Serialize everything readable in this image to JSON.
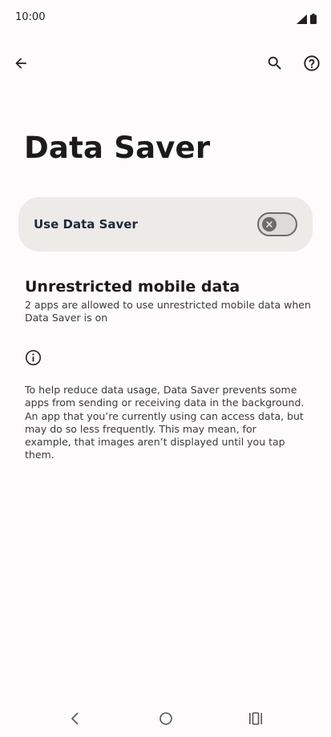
{
  "status_bar": {
    "time": "10:00",
    "icons": [
      "signal-icon",
      "battery-icon"
    ]
  },
  "toolbar": {
    "back_icon": "arrow-back-icon",
    "search_icon": "search-icon",
    "help_icon": "help-icon"
  },
  "page": {
    "title": "Data Saver"
  },
  "main_switch": {
    "label": "Use Data Saver",
    "state": "off"
  },
  "unrestricted_pref": {
    "title": "Unrestricted mobile data",
    "summary": "2 apps are allowed to use unrestricted mobile data when Data Saver is on"
  },
  "footer": {
    "icon": "info-icon",
    "text": "To help reduce data usage, Data Saver prevents some apps from sending or receiving data in the background. An app that you’re currently using can access data, but may do so less frequently. This may mean, for example, that images aren’t displayed until you tap them."
  },
  "nav_bar": {
    "icons": [
      "nav-back-icon",
      "nav-home-icon",
      "nav-recents-icon"
    ]
  },
  "colors": {
    "background": "#fdfbfb",
    "card": "#eeeae7",
    "toggle_off": "#6e6a68",
    "text": "#1b1b1b"
  }
}
